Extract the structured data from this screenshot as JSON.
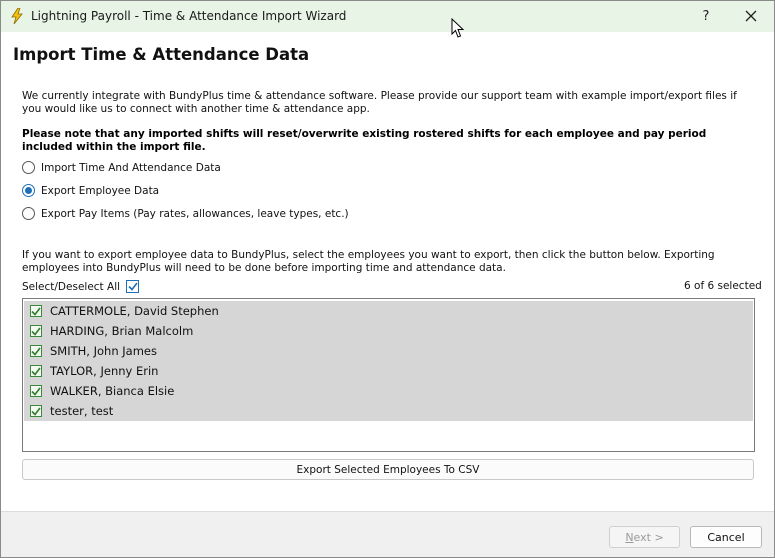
{
  "window": {
    "title": "Lightning Payroll - Time & Attendance Import Wizard",
    "help_label": "?",
    "title_bar_color": "#e8f4e6",
    "app_icon": "lightning-bolt-icon"
  },
  "page": {
    "title": "Import Time & Attendance Data",
    "intro": "We currently integrate with BundyPlus time & attendance software. Please provide our support team with example import/export files if you would like us to connect with another time & attendance app.",
    "warning": "Please note that any imported shifts will reset/overwrite existing rostered shifts for each employee and pay period included within the import file."
  },
  "options": [
    {
      "label": "Import Time And Attendance Data",
      "selected": false
    },
    {
      "label": "Export Employee Data",
      "selected": true
    },
    {
      "label": "Export Pay Items (Pay rates, allowances, leave types, etc.)",
      "selected": false
    }
  ],
  "export": {
    "info": "If you want to export employee data to BundyPlus, select the employees you want to export, then click the button below. Exporting employees into BundyPlus will need to be done before importing time and attendance data.",
    "select_all_label": "Select/Deselect All",
    "select_all_checked": true,
    "selected_count": "6 of 6 selected",
    "employees": [
      {
        "name": "CATTERMOLE, David Stephen",
        "checked": true
      },
      {
        "name": "HARDING, Brian Malcolm",
        "checked": true
      },
      {
        "name": "SMITH, John James",
        "checked": true
      },
      {
        "name": "TAYLOR, Jenny Erin",
        "checked": true
      },
      {
        "name": "WALKER, Bianca Elsie",
        "checked": true
      },
      {
        "name": "tester, test",
        "checked": true
      }
    ],
    "button_label": "Export Selected Employees To CSV"
  },
  "footer": {
    "next_label_accel": "N",
    "next_label_rest": "ext >",
    "next_enabled": false,
    "cancel_label": "Cancel"
  },
  "colors": {
    "accent": "#1f6fb8",
    "checkbox_green": "#3a8a3a",
    "row_selected": "#d6d6d6"
  }
}
